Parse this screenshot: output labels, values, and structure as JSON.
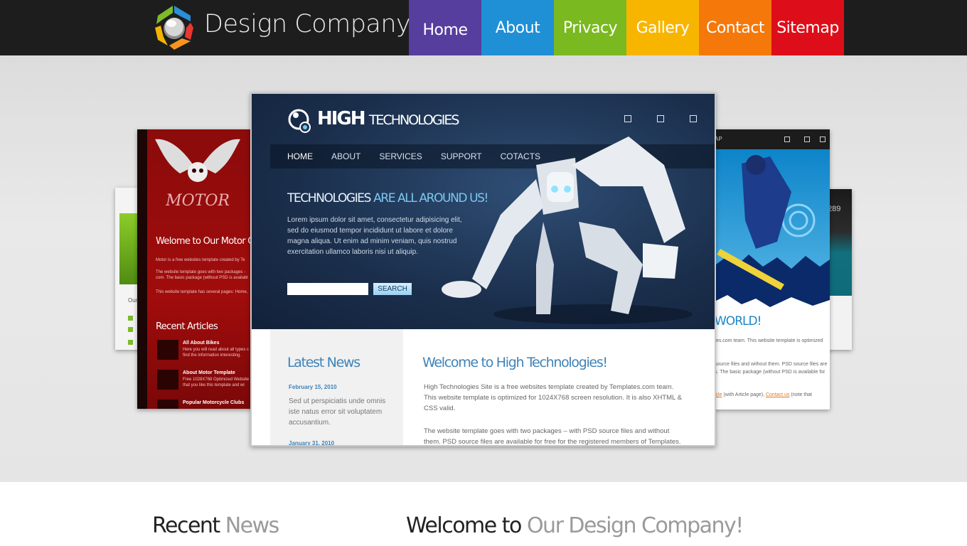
{
  "header": {
    "brand": "Design Company",
    "logo_icon": "logo-icon",
    "nav": [
      {
        "label": "Home",
        "color": "#563e9e",
        "active": true
      },
      {
        "label": "About",
        "color": "#1f8fd6"
      },
      {
        "label": "Privacy",
        "color": "#7ab920"
      },
      {
        "label": "Gallery",
        "color": "#f8b500"
      },
      {
        "label": "Contact",
        "color": "#f5780b"
      },
      {
        "label": "Sitemap",
        "color": "#dd0e19"
      }
    ]
  },
  "showcase": {
    "motor": {
      "logo_text": "MOTOR",
      "title": "Welome to Our Motor Club",
      "lines": [
        "Motor is a free websites template created by Te",
        "The website template goes with two packages -",
        "com. The basic package (without PSD is available",
        "This website template has several pages: Home,"
      ],
      "recent": "Recent Articles",
      "articles": [
        {
          "title": "All About Bikes",
          "lines": [
            "Here you will read about all types c",
            "find the information interesting."
          ]
        },
        {
          "title": "About Motor Template",
          "lines": [
            "Free 1028X768 Optimized Website",
            "that you like this template and wi"
          ]
        },
        {
          "title": "Popular Motorcycle Clubs",
          "lines": []
        }
      ]
    },
    "main": {
      "name1": "HIGH",
      "name2": "TECHNOLOGIES",
      "menu": [
        "HOME",
        "ABOUT",
        "SERVICES",
        "SUPPORT",
        "COTACTS"
      ],
      "tag1": "TECHNOLOGIES",
      "tag2": "ARE ALL AROUND US!",
      "lorem": "Lorem ipsum dolor sit amet, consectetur adipisicing elit, sed do eiusmod tempor incididunt ut labore et dolore magna aliqua. Ut enim ad minim veniam, quis nostrud exercitation ullamco laboris nisi ut aliquip.",
      "search_label": "SEARCH",
      "latest": "Latest News",
      "date1": "February 15, 2010",
      "news1": "Sed ut perspiciatis unde omnis iste natus error sit voluptatem accusantium.",
      "date2": "January 31, 2010",
      "welcome": "Welcome to High Technologies!",
      "p1": "High Technologies Site is a free websites template created by Templates.com team. This website template is optimized for 1024X768 screen resolution. It is also XHTML & CSS valid.",
      "p2": "The website template goes with two packages – with PSD source files and without them. PSD source files are available for free for the registered members of Templates."
    },
    "snow": {
      "map_partial": "AP",
      "world": "WORLD!",
      "lines": [
        "tes.com team. This website template is optimized",
        "source files and without them. PSD source files are",
        "s. The basic package (without PSD is available for"
      ],
      "link1": "icle",
      "link_mid": " (with Article page), ",
      "link2": "Contact us",
      "link_end": " (note that"
    },
    "far_right_num": "289",
    "far_left_text": "Our"
  },
  "bottom": {
    "recent1": "Recent",
    "recent2": "News",
    "welcome1": "Welcome to",
    "welcome2": "Our Design Company!"
  }
}
